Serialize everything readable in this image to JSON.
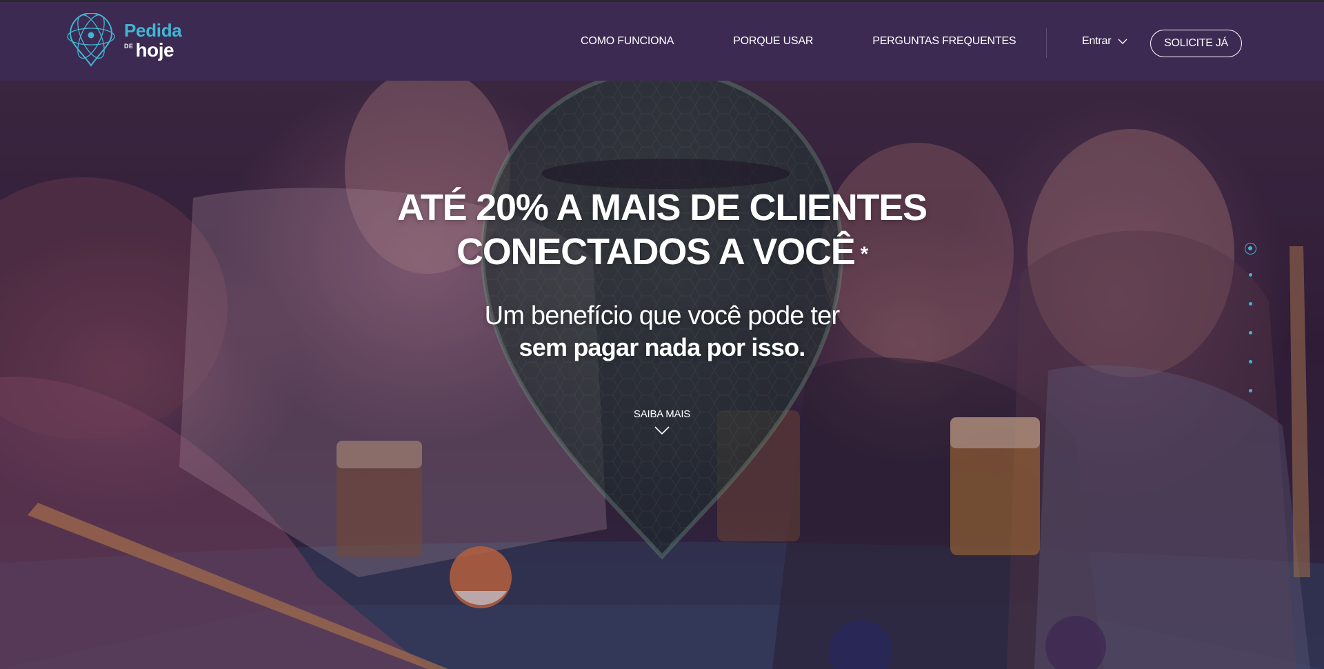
{
  "brand": {
    "name_line1": "Pedida",
    "name_de": "DE",
    "name_line2": "hoje",
    "accent_color": "#3fb6d3",
    "nav_bg_color": "#3d2a52",
    "logo_icon": "map-pin-globe-icon"
  },
  "nav": {
    "links": [
      {
        "label": "COMO FUNCIONA"
      },
      {
        "label": "PORQUE USAR"
      },
      {
        "label": "PERGUNTAS FREQUENTES"
      }
    ],
    "login_label": "Entrar",
    "login_icon": "chevron-down-icon",
    "cta_label": "SOLICITE JÁ"
  },
  "hero": {
    "headline_line1": "ATÉ 20% A MAIS DE CLIENTES",
    "headline_line2": "CONECTADOS A VOCÊ",
    "headline_mark": "*",
    "sub_line1": "Um benefício que você pode ter",
    "sub_line2": "sem pagar nada por isso.",
    "scroll_label": "SAIBA MAIS",
    "scroll_icon": "chevron-down-icon",
    "background_description_icon": "map-pin-watermark",
    "slide_indicator": {
      "total": 6,
      "active": 1
    }
  }
}
